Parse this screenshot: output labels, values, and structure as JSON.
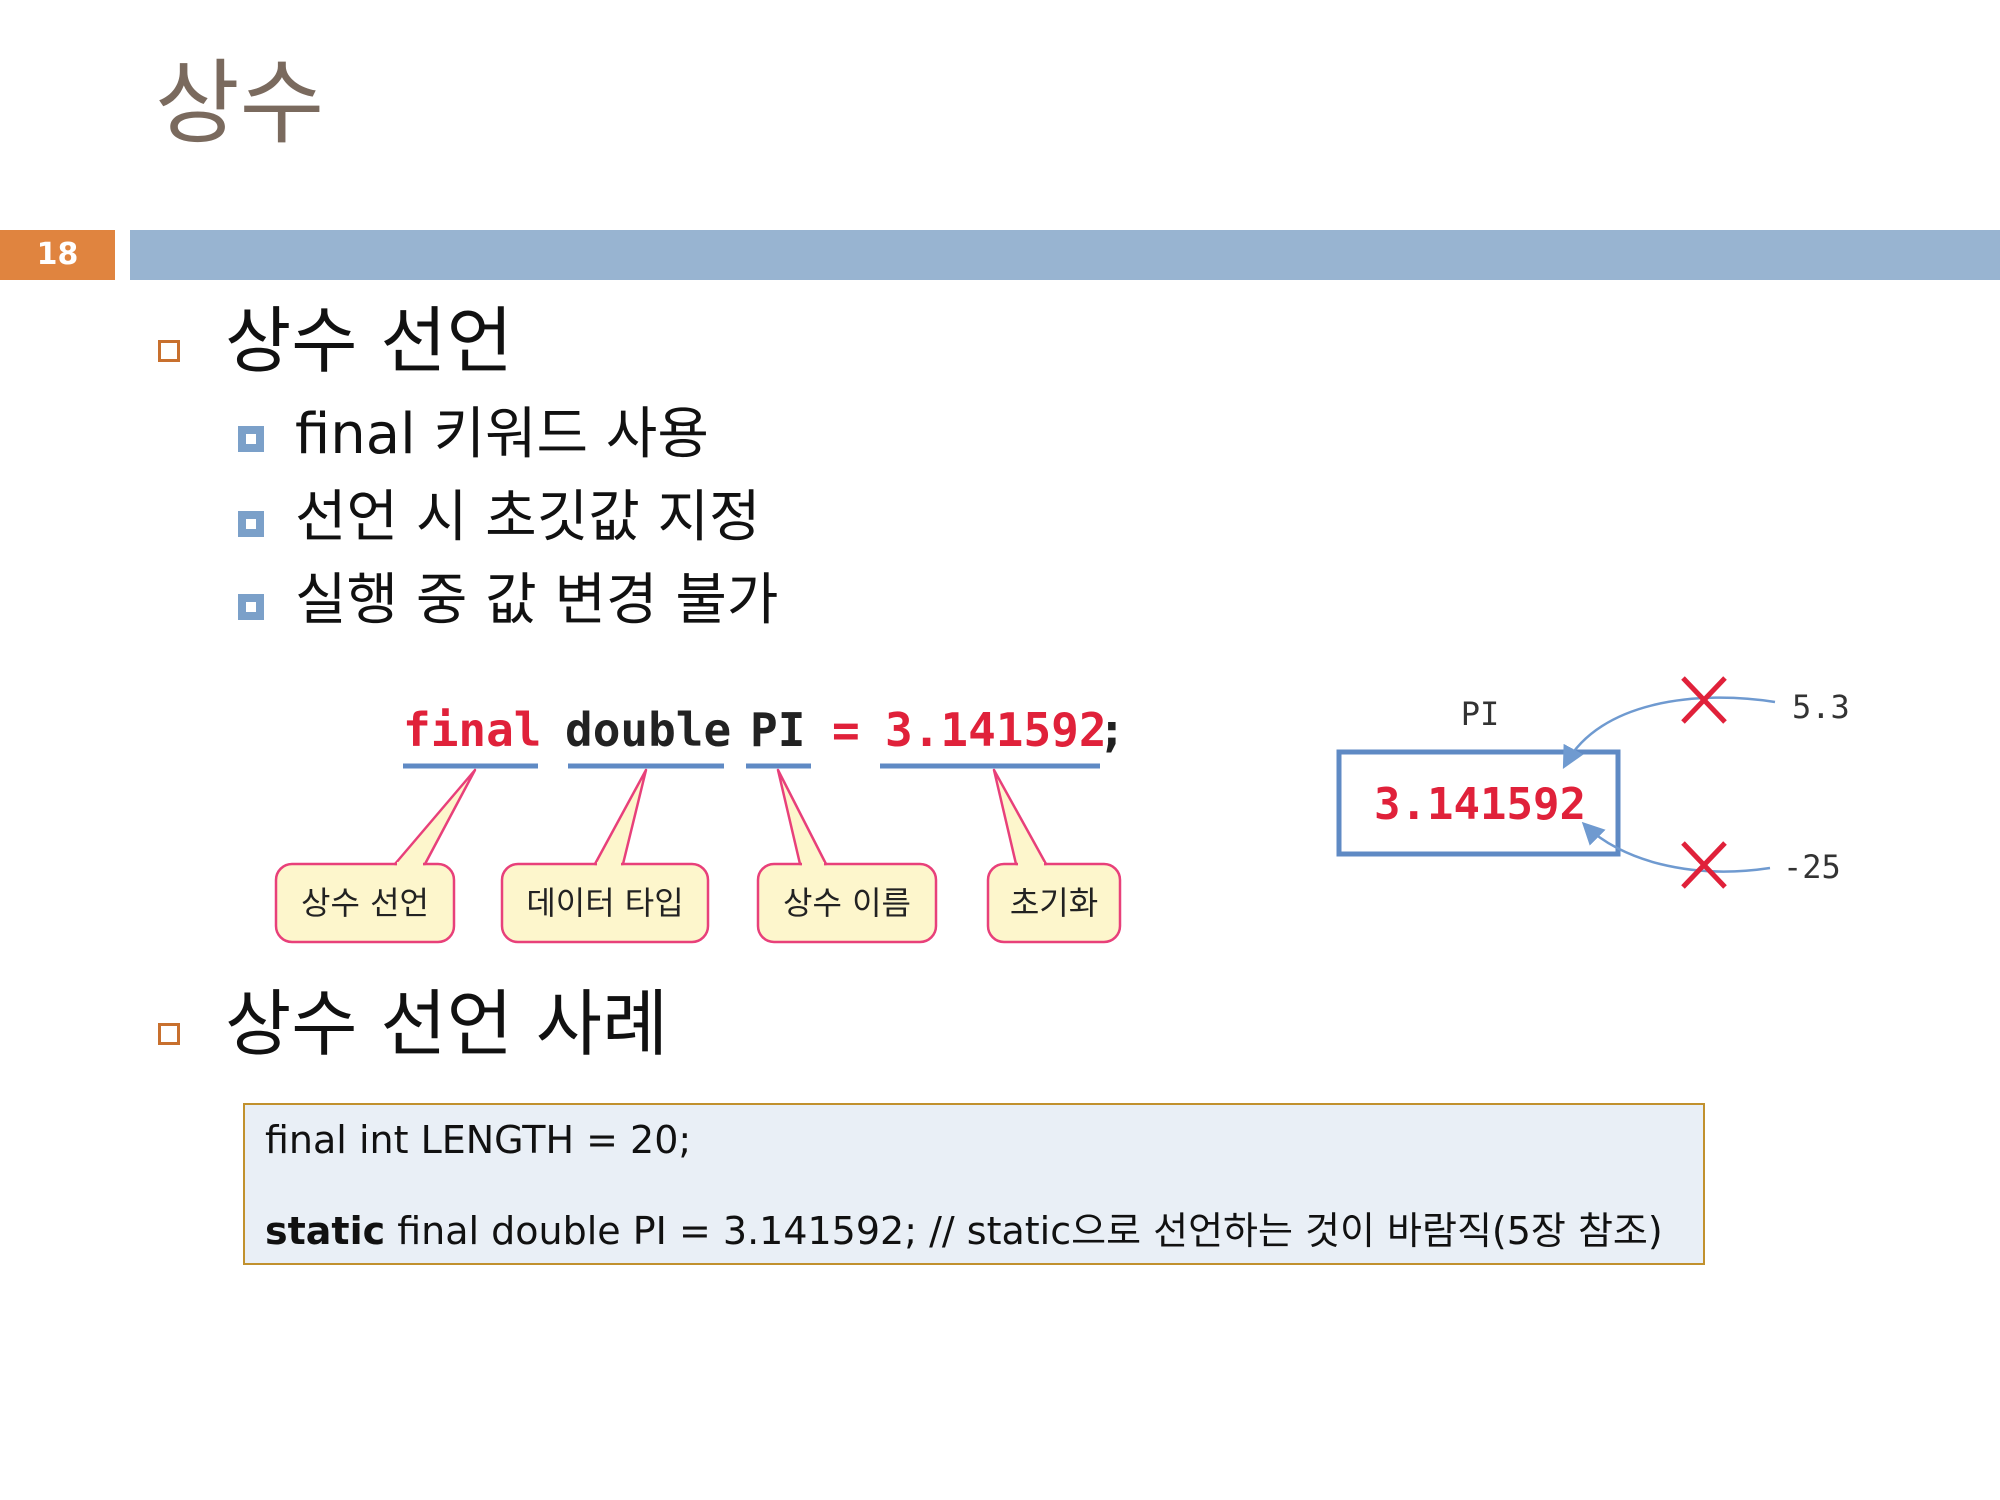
{
  "slide": {
    "title": "상수",
    "number": "18"
  },
  "section1": {
    "heading": "상수 선언",
    "items": [
      "final 키워드 사용",
      "선언 시 초깃값 지정",
      "실행 중 값 변경 불가"
    ]
  },
  "diagram_code": {
    "kw_final": "final",
    "kw_double": "double",
    "name_pi": "PI",
    "equals": "=",
    "value": "3.141592",
    "semicolon": ";",
    "callouts": [
      "상수 선언",
      "데이터 타입",
      "상수 이름",
      "초기화"
    ],
    "colors": {
      "keyword": "#e0213a",
      "underline": "#5f8ac4",
      "callout_fill": "#fdf6cc",
      "callout_border": "#e8407a"
    }
  },
  "diagram_pi": {
    "label": "PI",
    "value": "3.141592",
    "attempt_top": "5.3",
    "attempt_bottom": "-25",
    "colors": {
      "box_border": "#5f8ac4",
      "cross": "#e0213a",
      "arrow": "#6f9ad0"
    }
  },
  "section2": {
    "heading": "상수 선언 사례",
    "code_line1": "final int LENGTH = 20;",
    "code_line2_bold": "static",
    "code_line2_rest": " final double PI = 3.141592; // static으로 선언하는 것이 바람직(5장 참조)"
  },
  "theme": {
    "title_color": "#7a6a5e",
    "number_bg": "#e0843f",
    "bar_color": "#98b4d1",
    "bullet_square": "#c8702e",
    "sub_bullet": "#7ba0c9"
  }
}
